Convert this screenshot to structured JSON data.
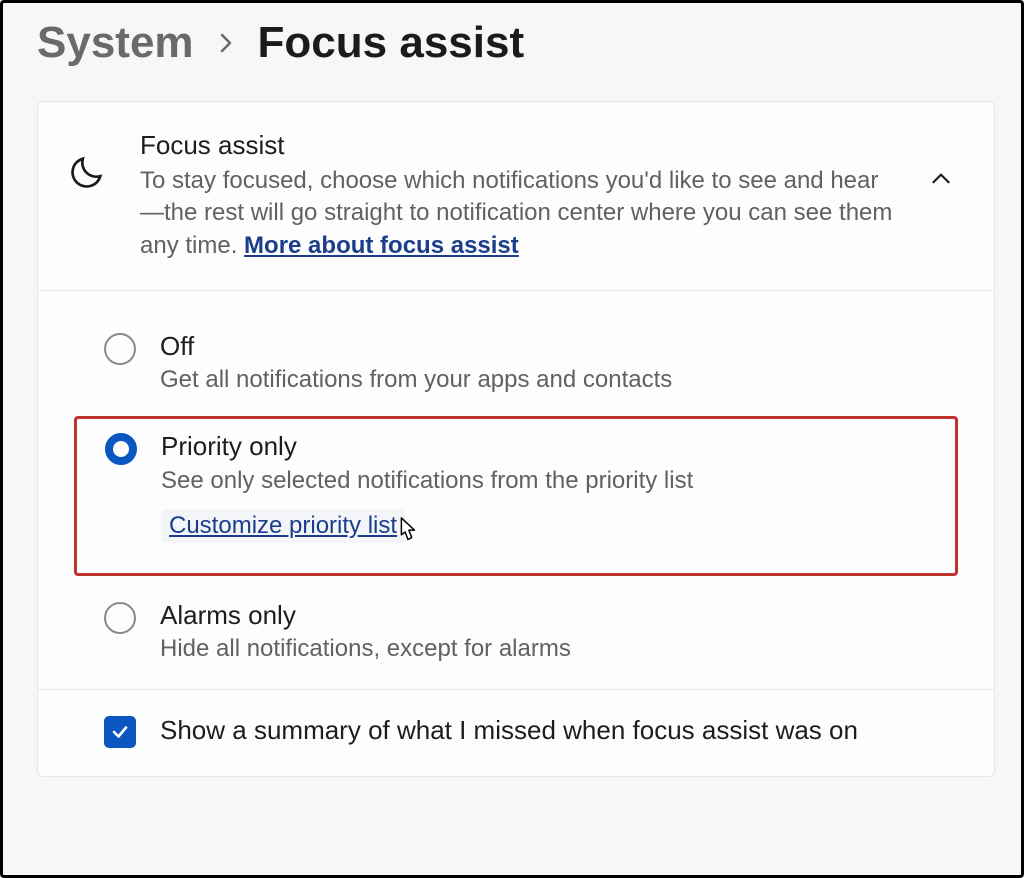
{
  "breadcrumb": {
    "parent": "System",
    "current": "Focus assist"
  },
  "header": {
    "title": "Focus assist",
    "desc_prefix": "To stay focused, choose which notifications you'd like to see and hear—the rest will go straight to notification center where you can see them any time.  ",
    "link_label": "More about focus assist"
  },
  "options": {
    "off": {
      "title": "Off",
      "desc": "Get all notifications from your apps and contacts"
    },
    "priority": {
      "title": "Priority only",
      "desc": "See only selected notifications from the priority list",
      "link": "Customize priority list"
    },
    "alarms": {
      "title": "Alarms only",
      "desc": "Hide all notifications, except for alarms"
    }
  },
  "summary_label": "Show a summary of what I missed when focus assist was on"
}
